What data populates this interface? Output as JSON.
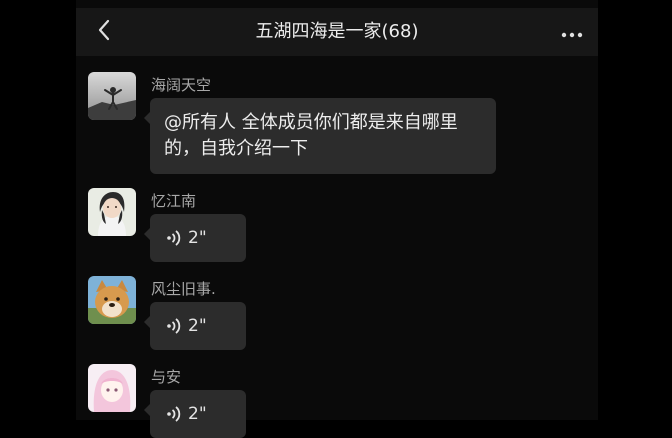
{
  "header": {
    "title": "五湖四海是一家(68)",
    "back_icon": "chevron-left-icon",
    "more_icon": "more-dots-icon"
  },
  "messages": [
    {
      "sender": "海阔天空",
      "type": "text",
      "text": "@所有人 全体成员你们都是来自哪里的，自我介绍一下"
    },
    {
      "sender": "忆江南",
      "type": "voice",
      "duration": "2\""
    },
    {
      "sender": "风尘旧事.",
      "type": "voice",
      "duration": "2\""
    },
    {
      "sender": "与安",
      "type": "voice",
      "duration": "2\""
    }
  ],
  "colors": {
    "background": "#000000",
    "header": "#171717",
    "bubble": "#2c2c2c",
    "sender_name": "#a8a8a8"
  }
}
